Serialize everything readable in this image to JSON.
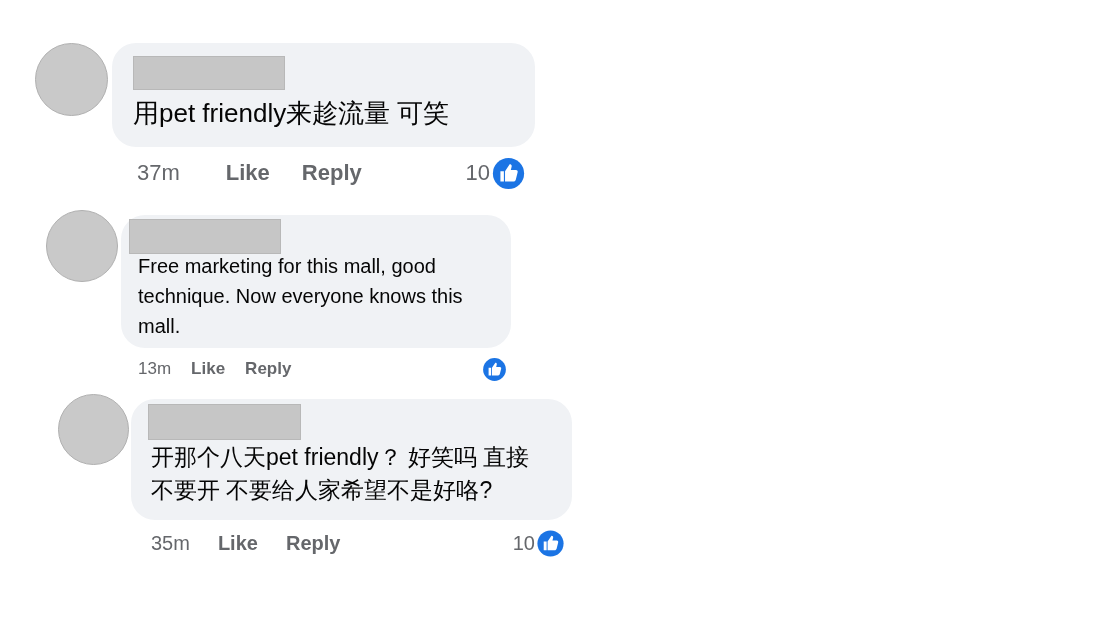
{
  "comments": [
    {
      "text": "用pet friendly来趁流量 可笑",
      "time": "37m",
      "actions": [
        "Like",
        "Reply"
      ],
      "reaction_count": "10"
    },
    {
      "text": "Free marketing for this mall, good technique. Now everyone knows this mall.",
      "time": "13m",
      "actions": [
        "Like",
        "Reply"
      ]
    },
    {
      "text": "开那个八天pet friendly？ 好笑吗 直接不要开 不要给人家希望不是好咯?",
      "time": "35m",
      "actions": [
        "Like",
        "Reply"
      ],
      "reaction_count": "10"
    }
  ]
}
